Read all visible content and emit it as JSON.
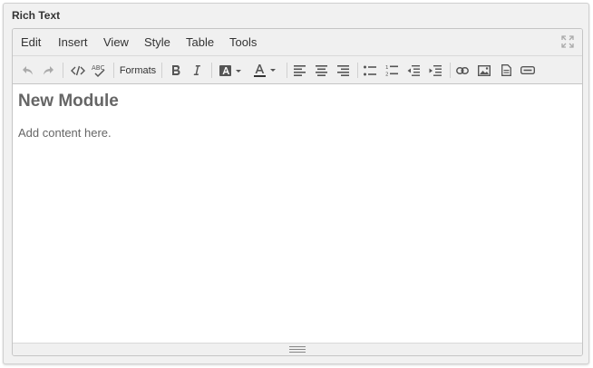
{
  "panel": {
    "title": "Rich Text"
  },
  "menubar": {
    "items": [
      {
        "label": "Edit"
      },
      {
        "label": "Insert"
      },
      {
        "label": "View"
      },
      {
        "label": "Style"
      },
      {
        "label": "Table"
      },
      {
        "label": "Tools"
      }
    ]
  },
  "toolbar": {
    "formats_label": "Formats",
    "icons": [
      "undo-icon",
      "redo-icon",
      "source-code-icon",
      "spellcheck-icon",
      "bold-icon",
      "italic-icon",
      "background-color-icon",
      "text-color-icon",
      "align-left-icon",
      "align-center-icon",
      "align-right-icon",
      "bullet-list-icon",
      "numbered-list-icon",
      "outdent-icon",
      "indent-icon",
      "link-icon",
      "image-icon",
      "document-icon",
      "media-icon",
      "fullscreen-icon"
    ],
    "colors": {
      "icon": "#555555",
      "disabled_icon": "#aaaaaa",
      "text_color_bar": "#333333"
    }
  },
  "content": {
    "heading": "New Module",
    "paragraph": "Add content here."
  }
}
